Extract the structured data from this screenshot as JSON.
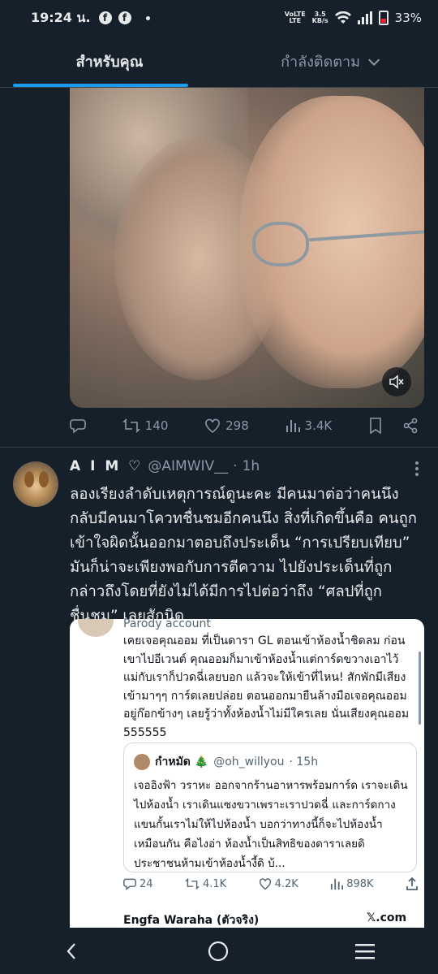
{
  "status_bar": {
    "time": "19:24 น.",
    "fb_glyph": "f",
    "net_top": "VoLTE",
    "net_bottom": "LTE",
    "speed_top": "3.5",
    "speed_bottom": "KB/s",
    "battery": "33%"
  },
  "tabs": [
    {
      "label": "สำหรับคุณ",
      "active": true
    },
    {
      "label": "กำลังติดตาม",
      "active": false
    }
  ],
  "media": {
    "mute_icon": "volume-muted-icon"
  },
  "media_actions": {
    "reply": "",
    "retweet": "140",
    "like": "298",
    "views": "3.4K"
  },
  "tweet": {
    "name": "A I M ♡",
    "handle": "@AIMWIV__",
    "separator": "·",
    "time": "1h",
    "text": "ลองเรียงลำดับเหตุการณ์ดูนะคะ มีคนมาต่อว่าคนนึง กลับมีคนมาโควทชื่นชมอีกคนนึง สิ่งที่เกิดขึ้นคือ คนถูกเข้าใจผิดนั้นออกมาตอบถึงประเด็น “การเปรียบเทียบ” มันก็น่าจะเพียงพอกับการตีความ ไปยังประเด็นที่ถูกกล่าวถึงโดยที่ยังไม่ได้มีการไปต่อว่าถึง “ศลปที่ถูกชื่นชม” เลยสักนิด"
  },
  "quote": {
    "label": "Parody account",
    "text": "เคยเจอคุณออม ที่เป็นดารา GL ตอนเข้าห้องน้ำชิดลม ก่อนเขาไปอีเวนต์ คุณออมก็มาเข้าห้องน้ำแต่การ์ดขวางเอาไว้ แม่กับเราก็ปวดฉี่เลยบอก แล้วจะให้เข้าที่ไหน! สักพักมีเสียงเข้ามาๆๆ การ์ดเลยปล่อย ตอนออกมายืนล้างมือเจอคุณออมอยู่ก๊อกข้างๆ เลยรู้ว่าทั้งห้องน้ำไม่มีใครเลย นั่นเสียงคุณออม 555555",
    "inner": {
      "name": "กำหมัด 🎄",
      "handle": "@oh_willyou",
      "time": "· 15h",
      "text": "เจออิงฟ้า วราหะ ออกจากร้านอาหารพร้อมการ์ด เราจะเดินไปห้องน้ำ เราเดินแซงขวาเพราะเราปวดฉี่ และการ์ดกางแขนกั้นเราไม่ให้ไปห้องน้ำ บอกว่าทางนี้ก็จะไปห้องน้ำเหมือนกัน คือไงอ่า ห้องน้ำเป็นสิทธิของดาราเลยดิ ประชาชนห้ามเข้าห้องน้ำงี้ดิ บ้..."
    },
    "actions": {
      "reply": "24",
      "retweet": "4.1K",
      "like": "4.2K",
      "views": "898K"
    },
    "next_name": "Engfa Waraha (ตัวจริง)",
    "x_label": "𝕏.com"
  },
  "nav": [
    "back-icon",
    "home-icon",
    "recents-icon"
  ],
  "colors": {
    "bg": "#15202b",
    "accent": "#1d9bf0",
    "muted": "#8b98a5",
    "text": "#e7e9ea"
  }
}
